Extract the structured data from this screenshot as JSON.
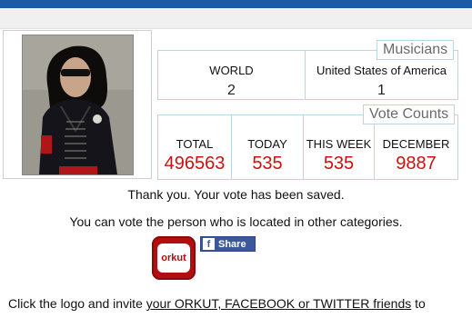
{
  "musicians": {
    "title": "Musicians",
    "world_label": "WORLD",
    "world_value": "2",
    "country_label": "United States of America",
    "country_value": "1"
  },
  "votes": {
    "title": "Vote Counts",
    "cols": [
      {
        "label": "TOTAL",
        "value": "496563"
      },
      {
        "label": "TODAY",
        "value": "535"
      },
      {
        "label": "THIS WEEK",
        "value": "535"
      },
      {
        "label": "DECEMBER",
        "value": "9887"
      }
    ]
  },
  "messages": {
    "saved": "Thank you. Your vote has been saved.",
    "other": "You can vote the person who is located in other categories."
  },
  "social": {
    "orkut_label": "orkut",
    "fb_icon": "f",
    "fb_share": "Share"
  },
  "invite": {
    "prefix": "Click the logo and invite ",
    "link": "your ORKUT, FACEBOOK or TWITTER friends",
    "suffix": " to"
  },
  "colors": {
    "accent_red": "#cc1111",
    "border_blue": "#b9d7e6",
    "header_blue": "#1a5aa6"
  }
}
